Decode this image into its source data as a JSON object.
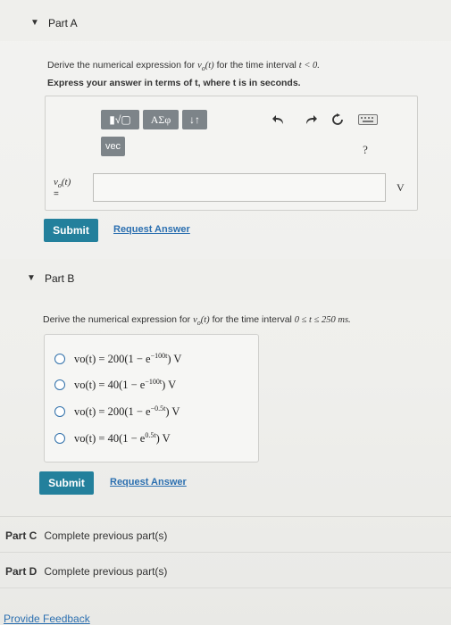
{
  "part_a": {
    "caret": "▼",
    "title": "Part A",
    "prompt_pre": "Derive the numerical expression for ",
    "prompt_var": "v",
    "prompt_sub": "o",
    "prompt_arg": "(t)",
    "prompt_mid": " for the time interval ",
    "prompt_cond": "t < 0.",
    "instruction": "Express your answer in terms of t, where t is in seconds.",
    "toolbar": {
      "templates": "▮√▢",
      "greek": "ΑΣφ",
      "arrows": "↓↑",
      "vec": "vec",
      "help": "?"
    },
    "label_var": "v",
    "label_sub": "o",
    "label_arg": "(t)",
    "label_eq": "=",
    "input_value": "",
    "unit": "V",
    "submit": "Submit",
    "request": "Request Answer"
  },
  "part_b": {
    "caret": "▼",
    "title": "Part B",
    "prompt_pre": "Derive the numerical expression for ",
    "prompt_var": "v",
    "prompt_sub": "o",
    "prompt_arg": "(t)",
    "prompt_mid": " for the time interval ",
    "prompt_cond": "0 ≤ t ≤ 250 ms.",
    "choices": [
      {
        "pre": "vo(t) = 200(1 − e",
        "exp": "−100t",
        "post": ") V"
      },
      {
        "pre": "vo(t) = 40(1 − e",
        "exp": "−100t",
        "post": ") V"
      },
      {
        "pre": "vo(t) = 200(1 − e",
        "exp": "−0.5t",
        "post": ") V"
      },
      {
        "pre": "vo(t) = 40(1 − e",
        "exp": "0.5t",
        "post": ") V"
      }
    ],
    "submit": "Submit",
    "request": "Request Answer"
  },
  "part_c": {
    "label": "Part C",
    "status": "Complete previous part(s)"
  },
  "part_d": {
    "label": "Part D",
    "status": "Complete previous part(s)"
  },
  "footer": {
    "feedback": "Provide Feedback"
  }
}
